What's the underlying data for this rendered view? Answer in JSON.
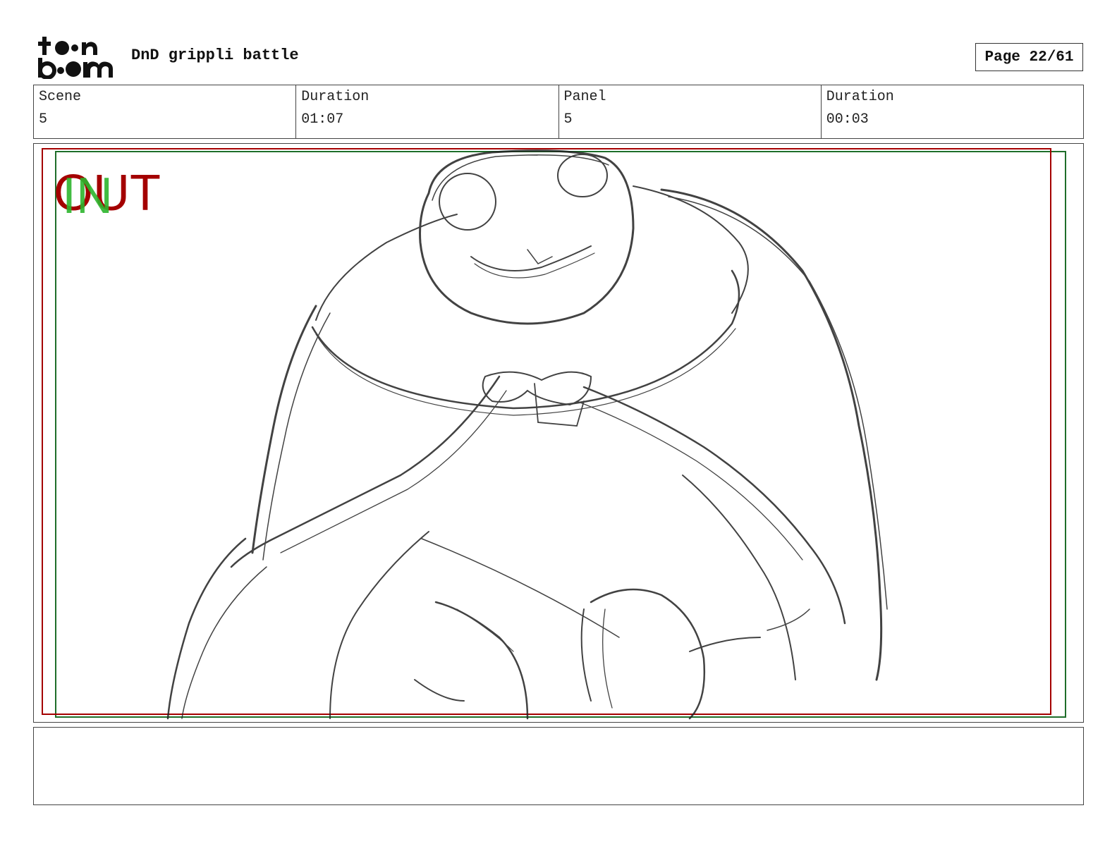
{
  "header": {
    "logo_text": "toon boom",
    "project_title": "DnD grippli battle",
    "page_label": "Page 22/61"
  },
  "info": {
    "scene_label": "Scene",
    "scene_value": "5",
    "scene_duration_label": "Duration",
    "scene_duration_value": "01:07",
    "panel_label": "Panel",
    "panel_value": "5",
    "panel_duration_label": "Duration",
    "panel_duration_value": "00:03"
  },
  "panel": {
    "marker_out": "OUT",
    "marker_in": "IN",
    "safe_frame_color": "#a40000",
    "camera_frame_color": "#1f6e2a",
    "sketch_subject": "frog-like creature sketch"
  },
  "caption": {
    "text": ""
  }
}
